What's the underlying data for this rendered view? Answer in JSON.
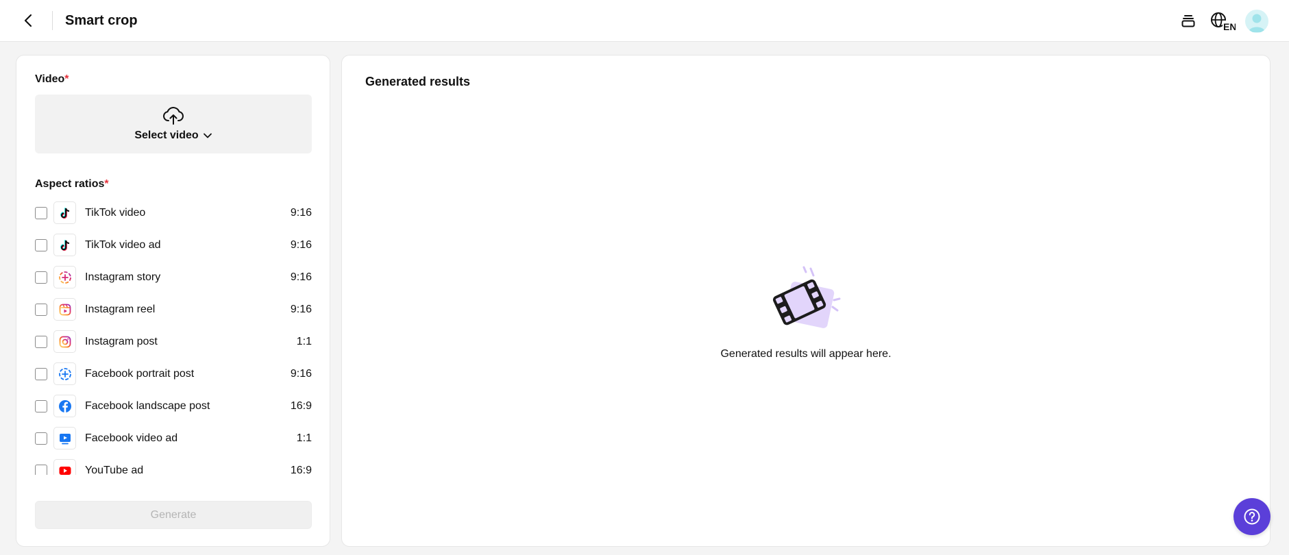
{
  "header": {
    "title": "Smart crop",
    "lang_code": "EN"
  },
  "left": {
    "video_label": "Video",
    "required_mark": "*",
    "select_video": "Select video",
    "aspect_label": "Aspect ratios",
    "ratios": [
      {
        "name": "TikTok video",
        "ratio": "9:16",
        "icon": "tiktok-icon"
      },
      {
        "name": "TikTok video ad",
        "ratio": "9:16",
        "icon": "tiktok-icon"
      },
      {
        "name": "Instagram story",
        "ratio": "9:16",
        "icon": "instagram-story-icon"
      },
      {
        "name": "Instagram reel",
        "ratio": "9:16",
        "icon": "instagram-reel-icon"
      },
      {
        "name": "Instagram post",
        "ratio": "1:1",
        "icon": "instagram-icon"
      },
      {
        "name": "Facebook portrait post",
        "ratio": "9:16",
        "icon": "facebook-story-icon"
      },
      {
        "name": "Facebook landscape post",
        "ratio": "16:9",
        "icon": "facebook-icon"
      },
      {
        "name": "Facebook video ad",
        "ratio": "1:1",
        "icon": "facebook-video-icon"
      },
      {
        "name": "YouTube ad",
        "ratio": "16:9",
        "icon": "youtube-icon"
      }
    ],
    "generate": "Generate"
  },
  "right": {
    "title": "Generated results",
    "empty_text": "Generated results will appear here."
  },
  "colors": {
    "accent": "#5b3fd9",
    "required": "#e5303a",
    "illustration_bg": "#e2d5fb"
  }
}
